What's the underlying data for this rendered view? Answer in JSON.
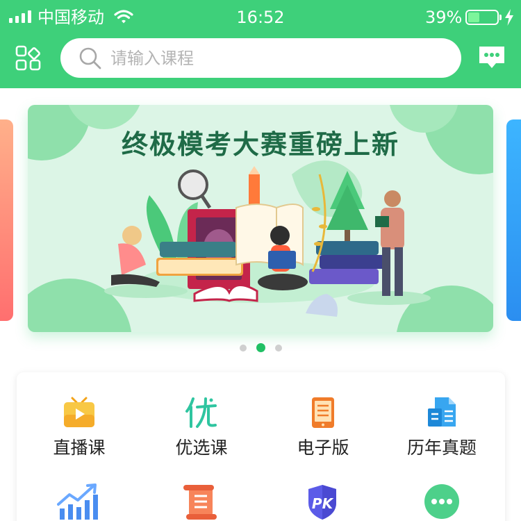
{
  "status_bar": {
    "carrier": "中国移动",
    "time": "16:52",
    "battery": "39%",
    "battery_level": 0.39
  },
  "header": {
    "search_placeholder": "请输入课程",
    "grid_icon": "grid-icon",
    "chat_icon": "chat-bubble-icon"
  },
  "banner": {
    "title": "终极模考大赛重磅上新",
    "slide_count": 3,
    "active_slide": 2
  },
  "menu": {
    "items": [
      {
        "label": "直播课",
        "icon": "tv-play-icon"
      },
      {
        "label": "优选课",
        "icon": "you-character-icon"
      },
      {
        "label": "电子版",
        "icon": "ebook-icon"
      },
      {
        "label": "历年真题",
        "icon": "document-icon"
      },
      {
        "label": "",
        "icon": "bar-chart-icon"
      },
      {
        "label": "",
        "icon": "scroll-icon"
      },
      {
        "label": "",
        "icon": "pk-shield-icon"
      },
      {
        "label": "",
        "icon": "more-icon"
      }
    ]
  },
  "colors": {
    "brand_green": "#3ed07a",
    "banner_bg": "#dcf5e6",
    "title_green": "#1f6b47",
    "dot_active": "#20c064"
  }
}
